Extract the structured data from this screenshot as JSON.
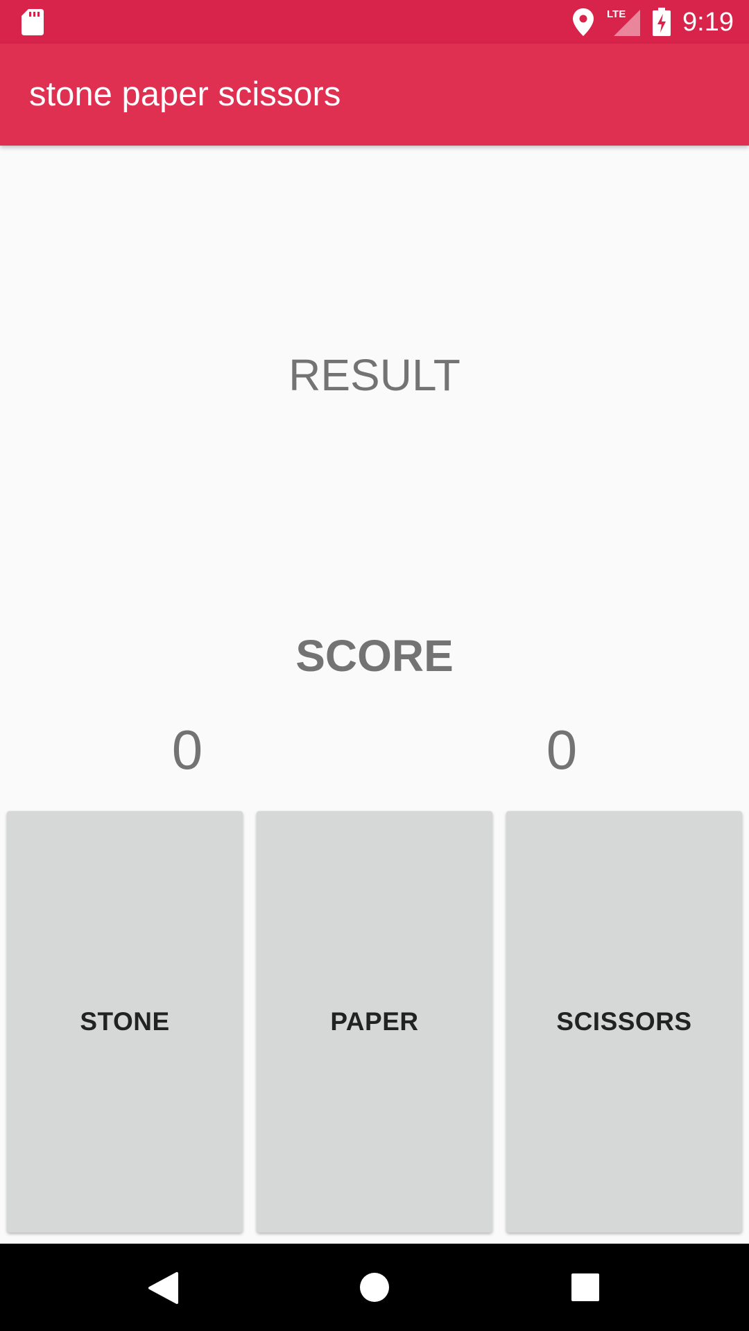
{
  "status_bar": {
    "time": "9:19",
    "network_label": "LTE",
    "icons": [
      "sd-card-icon",
      "location-icon",
      "lte-signal-icon",
      "battery-charging-icon"
    ]
  },
  "app_bar": {
    "title": "stone paper scissors"
  },
  "main": {
    "result_label": "RESULT",
    "score_label": "SCORE",
    "player_score": "0",
    "computer_score": "0"
  },
  "buttons": {
    "stone": "STONE",
    "paper": "PAPER",
    "scissors": "SCISSORS"
  },
  "nav_bar": {
    "icons": [
      "back-icon",
      "home-icon",
      "recents-icon"
    ]
  },
  "colors": {
    "status_bar": "#d8244b",
    "app_bar": "#e03052",
    "background": "#fafafa",
    "button": "#d6d7d7",
    "text_grey": "#737373"
  }
}
